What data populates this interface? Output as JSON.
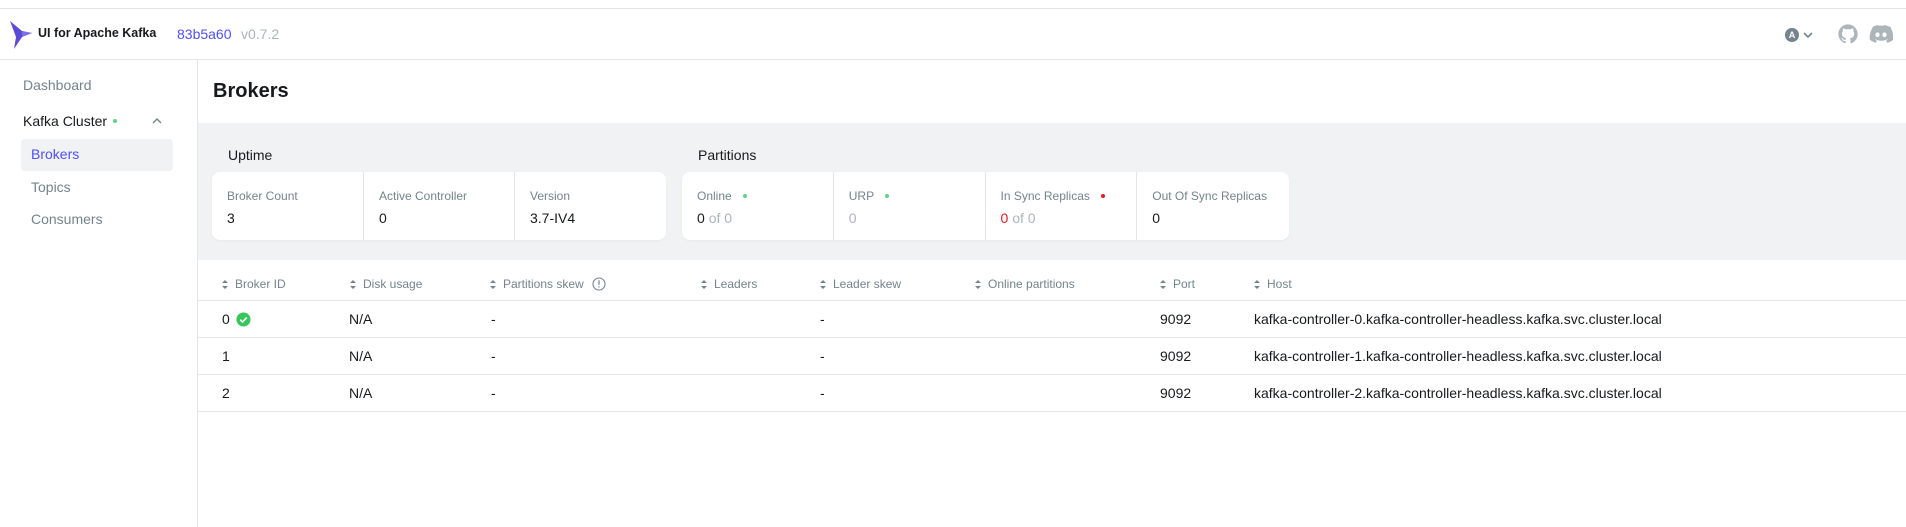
{
  "header": {
    "app_title": "UI for Apache Kafka",
    "commit": "83b5a60",
    "version": "v0.7.2",
    "user_initial": "A"
  },
  "sidebar": {
    "dashboard": "Dashboard",
    "cluster": "Kafka Cluster",
    "items": [
      {
        "label": "Brokers",
        "active": true
      },
      {
        "label": "Topics",
        "active": false
      },
      {
        "label": "Consumers",
        "active": false
      }
    ]
  },
  "page": {
    "title": "Brokers"
  },
  "metrics": {
    "uptime": {
      "label": "Uptime",
      "cards": [
        {
          "label": "Broker Count",
          "value": "3"
        },
        {
          "label": "Active Controller",
          "value": "0"
        },
        {
          "label": "Version",
          "value": "3.7-IV4"
        }
      ]
    },
    "partitions": {
      "label": "Partitions",
      "online": {
        "label": "Online",
        "value": "0",
        "total": "of 0"
      },
      "urp": {
        "label": "URP",
        "value": "0"
      },
      "in_sync": {
        "label": "In Sync Replicas",
        "value": "0",
        "total": "of 0"
      },
      "out_of_sync": {
        "label": "Out Of Sync Replicas",
        "value": "0"
      }
    }
  },
  "table": {
    "headers": {
      "broker_id": "Broker ID",
      "disk_usage": "Disk usage",
      "partitions_skew": "Partitions skew",
      "leaders": "Leaders",
      "leader_skew": "Leader skew",
      "online_partitions": "Online partitions",
      "port": "Port",
      "host": "Host"
    },
    "rows": [
      {
        "id": "0",
        "disk": "N/A",
        "pskew": "-",
        "leaders": "",
        "lskew": "-",
        "online": "",
        "port": "9092",
        "host": "kafka-controller-0.kafka-controller-headless.kafka.svc.cluster.local"
      },
      {
        "id": "1",
        "disk": "N/A",
        "pskew": "-",
        "leaders": "",
        "lskew": "-",
        "online": "",
        "port": "9092",
        "host": "kafka-controller-1.kafka-controller-headless.kafka.svc.cluster.local"
      },
      {
        "id": "2",
        "disk": "N/A",
        "pskew": "-",
        "leaders": "",
        "lskew": "-",
        "online": "",
        "port": "9092",
        "host": "kafka-controller-2.kafka-controller-headless.kafka.svc.cluster.local"
      }
    ]
  },
  "colors": {
    "accent": "#4f4fff",
    "success": "#5cd685",
    "danger": "#e51a1a",
    "muted": "#73848c",
    "panel": "#f1f2f3"
  }
}
